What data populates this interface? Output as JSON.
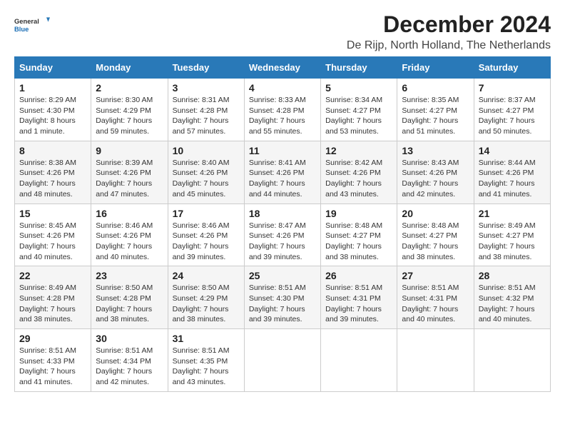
{
  "logo": {
    "general": "General",
    "blue": "Blue"
  },
  "title": "December 2024",
  "subtitle": "De Rijp, North Holland, The Netherlands",
  "days_of_week": [
    "Sunday",
    "Monday",
    "Tuesday",
    "Wednesday",
    "Thursday",
    "Friday",
    "Saturday"
  ],
  "weeks": [
    [
      {
        "day": "1",
        "sunrise": "Sunrise: 8:29 AM",
        "sunset": "Sunset: 4:30 PM",
        "daylight": "Daylight: 8 hours and 1 minute."
      },
      {
        "day": "2",
        "sunrise": "Sunrise: 8:30 AM",
        "sunset": "Sunset: 4:29 PM",
        "daylight": "Daylight: 7 hours and 59 minutes."
      },
      {
        "day": "3",
        "sunrise": "Sunrise: 8:31 AM",
        "sunset": "Sunset: 4:28 PM",
        "daylight": "Daylight: 7 hours and 57 minutes."
      },
      {
        "day": "4",
        "sunrise": "Sunrise: 8:33 AM",
        "sunset": "Sunset: 4:28 PM",
        "daylight": "Daylight: 7 hours and 55 minutes."
      },
      {
        "day": "5",
        "sunrise": "Sunrise: 8:34 AM",
        "sunset": "Sunset: 4:27 PM",
        "daylight": "Daylight: 7 hours and 53 minutes."
      },
      {
        "day": "6",
        "sunrise": "Sunrise: 8:35 AM",
        "sunset": "Sunset: 4:27 PM",
        "daylight": "Daylight: 7 hours and 51 minutes."
      },
      {
        "day": "7",
        "sunrise": "Sunrise: 8:37 AM",
        "sunset": "Sunset: 4:27 PM",
        "daylight": "Daylight: 7 hours and 50 minutes."
      }
    ],
    [
      {
        "day": "8",
        "sunrise": "Sunrise: 8:38 AM",
        "sunset": "Sunset: 4:26 PM",
        "daylight": "Daylight: 7 hours and 48 minutes."
      },
      {
        "day": "9",
        "sunrise": "Sunrise: 8:39 AM",
        "sunset": "Sunset: 4:26 PM",
        "daylight": "Daylight: 7 hours and 47 minutes."
      },
      {
        "day": "10",
        "sunrise": "Sunrise: 8:40 AM",
        "sunset": "Sunset: 4:26 PM",
        "daylight": "Daylight: 7 hours and 45 minutes."
      },
      {
        "day": "11",
        "sunrise": "Sunrise: 8:41 AM",
        "sunset": "Sunset: 4:26 PM",
        "daylight": "Daylight: 7 hours and 44 minutes."
      },
      {
        "day": "12",
        "sunrise": "Sunrise: 8:42 AM",
        "sunset": "Sunset: 4:26 PM",
        "daylight": "Daylight: 7 hours and 43 minutes."
      },
      {
        "day": "13",
        "sunrise": "Sunrise: 8:43 AM",
        "sunset": "Sunset: 4:26 PM",
        "daylight": "Daylight: 7 hours and 42 minutes."
      },
      {
        "day": "14",
        "sunrise": "Sunrise: 8:44 AM",
        "sunset": "Sunset: 4:26 PM",
        "daylight": "Daylight: 7 hours and 41 minutes."
      }
    ],
    [
      {
        "day": "15",
        "sunrise": "Sunrise: 8:45 AM",
        "sunset": "Sunset: 4:26 PM",
        "daylight": "Daylight: 7 hours and 40 minutes."
      },
      {
        "day": "16",
        "sunrise": "Sunrise: 8:46 AM",
        "sunset": "Sunset: 4:26 PM",
        "daylight": "Daylight: 7 hours and 40 minutes."
      },
      {
        "day": "17",
        "sunrise": "Sunrise: 8:46 AM",
        "sunset": "Sunset: 4:26 PM",
        "daylight": "Daylight: 7 hours and 39 minutes."
      },
      {
        "day": "18",
        "sunrise": "Sunrise: 8:47 AM",
        "sunset": "Sunset: 4:26 PM",
        "daylight": "Daylight: 7 hours and 39 minutes."
      },
      {
        "day": "19",
        "sunrise": "Sunrise: 8:48 AM",
        "sunset": "Sunset: 4:27 PM",
        "daylight": "Daylight: 7 hours and 38 minutes."
      },
      {
        "day": "20",
        "sunrise": "Sunrise: 8:48 AM",
        "sunset": "Sunset: 4:27 PM",
        "daylight": "Daylight: 7 hours and 38 minutes."
      },
      {
        "day": "21",
        "sunrise": "Sunrise: 8:49 AM",
        "sunset": "Sunset: 4:27 PM",
        "daylight": "Daylight: 7 hours and 38 minutes."
      }
    ],
    [
      {
        "day": "22",
        "sunrise": "Sunrise: 8:49 AM",
        "sunset": "Sunset: 4:28 PM",
        "daylight": "Daylight: 7 hours and 38 minutes."
      },
      {
        "day": "23",
        "sunrise": "Sunrise: 8:50 AM",
        "sunset": "Sunset: 4:28 PM",
        "daylight": "Daylight: 7 hours and 38 minutes."
      },
      {
        "day": "24",
        "sunrise": "Sunrise: 8:50 AM",
        "sunset": "Sunset: 4:29 PM",
        "daylight": "Daylight: 7 hours and 38 minutes."
      },
      {
        "day": "25",
        "sunrise": "Sunrise: 8:51 AM",
        "sunset": "Sunset: 4:30 PM",
        "daylight": "Daylight: 7 hours and 39 minutes."
      },
      {
        "day": "26",
        "sunrise": "Sunrise: 8:51 AM",
        "sunset": "Sunset: 4:31 PM",
        "daylight": "Daylight: 7 hours and 39 minutes."
      },
      {
        "day": "27",
        "sunrise": "Sunrise: 8:51 AM",
        "sunset": "Sunset: 4:31 PM",
        "daylight": "Daylight: 7 hours and 40 minutes."
      },
      {
        "day": "28",
        "sunrise": "Sunrise: 8:51 AM",
        "sunset": "Sunset: 4:32 PM",
        "daylight": "Daylight: 7 hours and 40 minutes."
      }
    ],
    [
      {
        "day": "29",
        "sunrise": "Sunrise: 8:51 AM",
        "sunset": "Sunset: 4:33 PM",
        "daylight": "Daylight: 7 hours and 41 minutes."
      },
      {
        "day": "30",
        "sunrise": "Sunrise: 8:51 AM",
        "sunset": "Sunset: 4:34 PM",
        "daylight": "Daylight: 7 hours and 42 minutes."
      },
      {
        "day": "31",
        "sunrise": "Sunrise: 8:51 AM",
        "sunset": "Sunset: 4:35 PM",
        "daylight": "Daylight: 7 hours and 43 minutes."
      },
      null,
      null,
      null,
      null
    ]
  ]
}
